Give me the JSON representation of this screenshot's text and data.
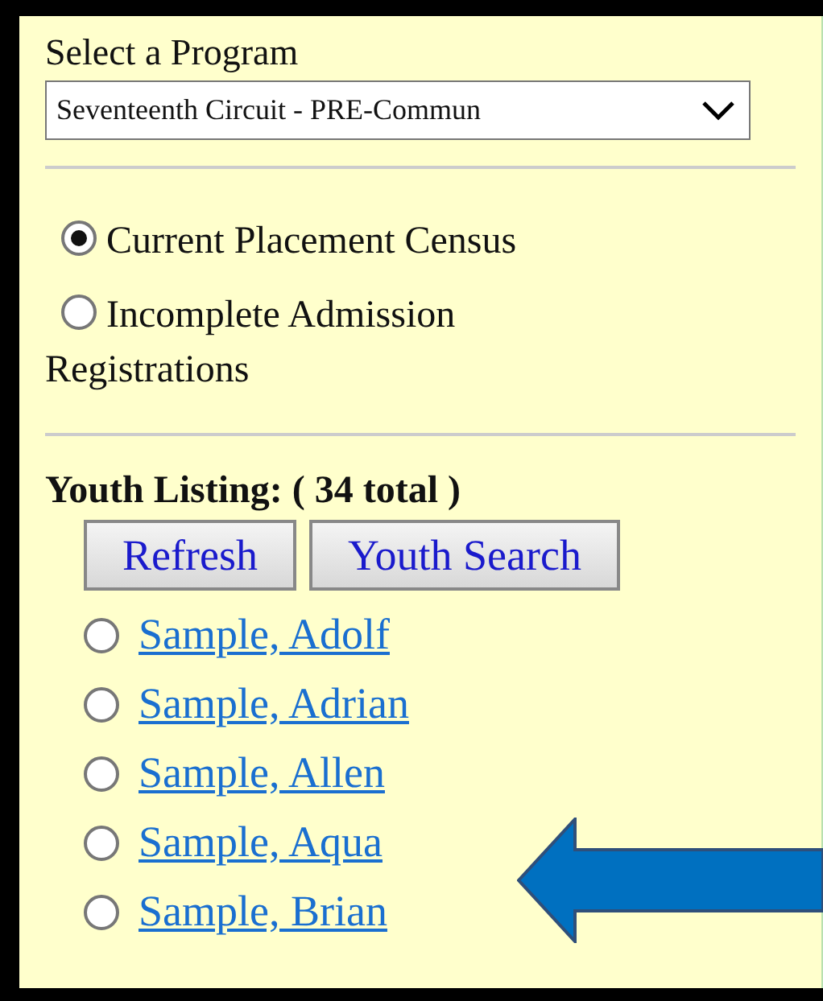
{
  "program": {
    "label": "Select a Program",
    "value": "Seventeenth Circuit - PRE-Commun"
  },
  "views": [
    {
      "label": "Current Placement Census",
      "selected": true
    },
    {
      "label": "Incomplete Admission Registrations",
      "selected": false
    }
  ],
  "listing": {
    "title": "Youth Listing: ( 34 total )",
    "buttons": [
      "Refresh",
      "Youth Search"
    ],
    "youth": [
      {
        "name": "Sample, Adolf",
        "selected": false
      },
      {
        "name": "Sample, Adrian",
        "selected": false
      },
      {
        "name": "Sample, Allen",
        "selected": false
      },
      {
        "name": "Sample, Aqua",
        "selected": false
      },
      {
        "name": "Sample, Brian",
        "selected": false
      }
    ]
  },
  "annotation": {
    "kind": "arrow"
  }
}
